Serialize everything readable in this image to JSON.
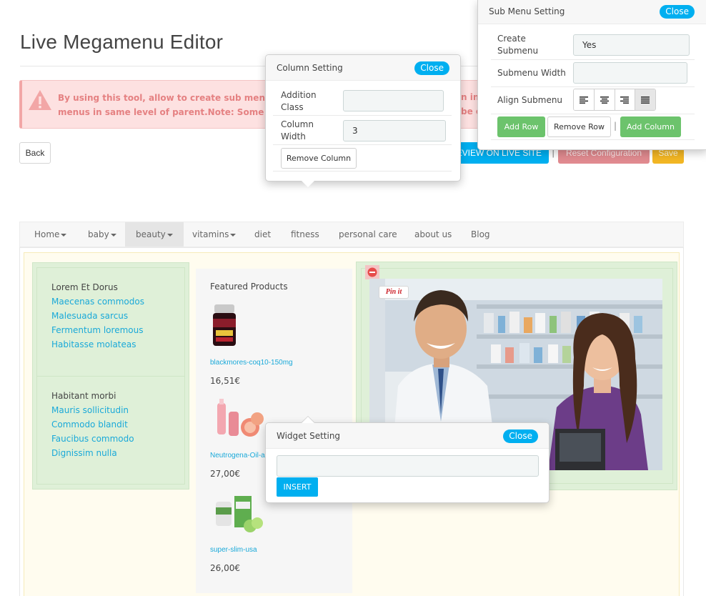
{
  "page": {
    "title": "Live Megamenu Editor",
    "alert_text_line1": "By using this tool, allow to create sub menu havi",
    "alert_text_line2": "menus in same level of parent.Note: Some config",
    "alert_text_right1": "n in",
    "alert_text_right2": "be c"
  },
  "toolbar": {
    "back_label": "Back",
    "preview_label": "PREVIEW ON LIVE SITE",
    "separator": "|",
    "reset_label": "Reset Configuration",
    "save_label": "Save"
  },
  "nav": {
    "items": [
      {
        "label": "Home"
      },
      {
        "label": "baby"
      },
      {
        "label": "beauty"
      },
      {
        "label": "vitamins"
      },
      {
        "label": "diet"
      },
      {
        "label": "fitness"
      },
      {
        "label": "personal care"
      },
      {
        "label": "about us"
      },
      {
        "label": "Blog"
      }
    ]
  },
  "menu_col1": {
    "group1": {
      "title": "Lorem Et Dorus",
      "links": [
        "Maecenas commodos",
        "Malesuada sarcus",
        "Fermentum loremous",
        "Habitasse molateas"
      ]
    },
    "group2": {
      "title": "Habitant morbi",
      "links": [
        "Mauris sollicitudin",
        "Commodo blandit",
        "Faucibus commodo",
        "Dignissim nulla"
      ]
    }
  },
  "menu_col2": {
    "title": "Featured Products",
    "products": [
      {
        "name": "blackmores-coq10-150mg",
        "price": "16,51€"
      },
      {
        "name": "Neutrogena-Oil-ac",
        "price": "27,00€"
      },
      {
        "name": "super-slim-usa",
        "price": "26,00€"
      }
    ]
  },
  "menu_col3": {
    "pin_label": "Pin it"
  },
  "column_setting": {
    "title": "Column Setting",
    "close_label": "Close",
    "addition_class_label": "Addition Class",
    "addition_class_value": "",
    "column_width_label": "Column Width",
    "column_width_value": "3",
    "remove_column_label": "Remove Column"
  },
  "submenu_setting": {
    "title": "Sub Menu Setting",
    "close_label": "Close",
    "create_submenu_label": "Create Submenu",
    "create_submenu_value": "Yes",
    "submenu_width_label": "Submenu Width",
    "submenu_width_value": "",
    "align_submenu_label": "Align Submenu",
    "add_row_label": "Add Row",
    "remove_row_label": "Remove Row",
    "separator": "|",
    "add_column_label": "Add Column"
  },
  "widget_setting": {
    "title": "Widget Setting",
    "close_label": "Close",
    "select_value": "",
    "insert_label": "INSERT"
  },
  "colors": {
    "accent": "#00aff0",
    "link": "#1aa9d9",
    "danger": "#e08a8f",
    "warning": "#f2b624",
    "success": "#6cc36c",
    "column_bg": "#dff0d8"
  }
}
